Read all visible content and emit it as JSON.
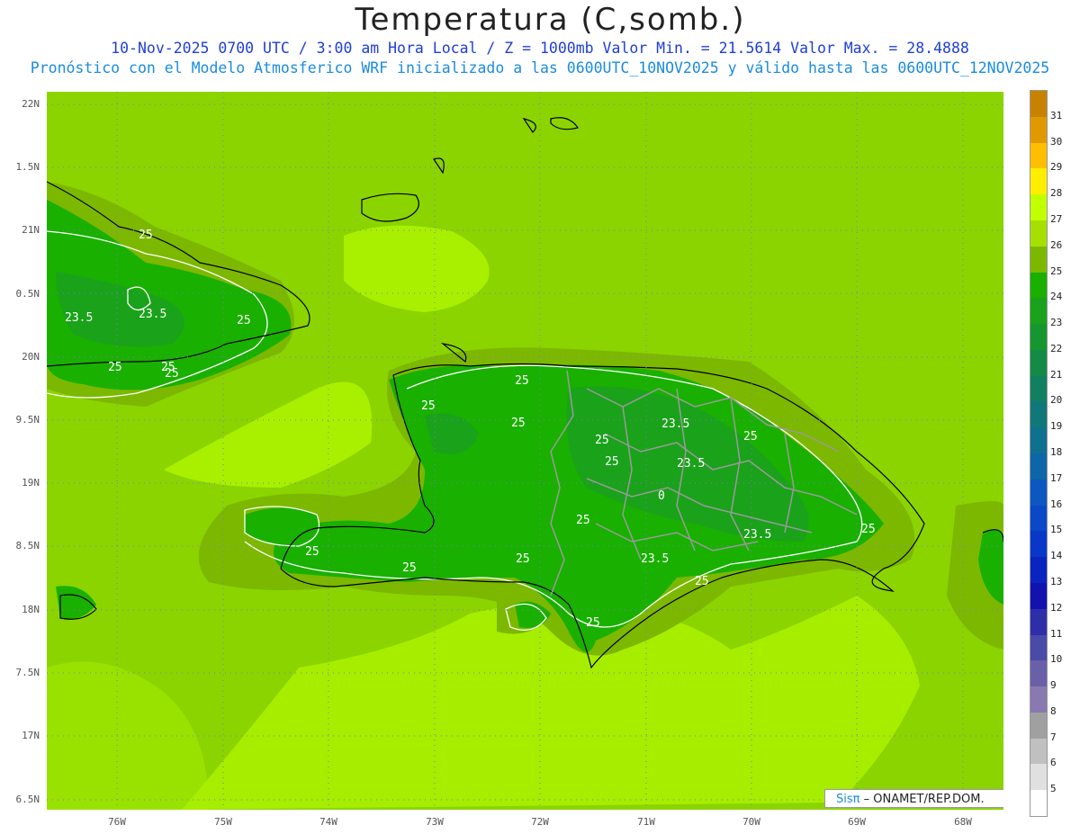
{
  "title": "Temperatura (C,somb.)",
  "subtitle_line1": "10-Nov-2025  0700 UTC / 3:00 am Hora Local / Z = 1000mb   Valor Min. = 21.5614  Valor Max. = 28.4888",
  "subtitle_line2": "Pronóstico con el Modelo Atmosferico WRF inicializado a las 0600UTC_10NOV2025 y válido hasta las  0600UTC_12NOV2025",
  "lat_labels": [
    "22N",
    "1.5N",
    "21N",
    "0.5N",
    "20N",
    "9.5N",
    "19N",
    "8.5N",
    "18N",
    "7.5N",
    "17N",
    "6.5N"
  ],
  "lon_labels": [
    "76W",
    "75W",
    "74W",
    "73W",
    "72W",
    "71W",
    "70W",
    "69W",
    "68W"
  ],
  "colorbar": {
    "labels": [
      "31",
      "30",
      "29",
      "28",
      "27",
      "26",
      "25",
      "24",
      "23",
      "22",
      "21",
      "20",
      "19",
      "18",
      "17",
      "16",
      "15",
      "14",
      "13",
      "12",
      "11",
      "10",
      "9",
      "8",
      "7",
      "6",
      "5"
    ],
    "colors": [
      "#c88200",
      "#e09a00",
      "#ffbe00",
      "#ffee00",
      "#c2ff00",
      "#a6e000",
      "#7cb800",
      "#19b000",
      "#1aa21a",
      "#16962e",
      "#148a46",
      "#128060",
      "#107878",
      "#0f7090",
      "#0d66a8",
      "#0b58c0",
      "#0a48c8",
      "#0938c8",
      "#0a24c0",
      "#1212b0",
      "#2e2ea8",
      "#4a4aa8",
      "#6a60a8",
      "#8a78b0",
      "#a0a0a0",
      "#c0c0c0",
      "#e0e0e0",
      "#ffffff"
    ]
  },
  "contour_labels": [
    "25",
    "23.5",
    "23.5",
    "25",
    "25",
    "25",
    "25",
    "25",
    "25",
    "25",
    "23.5",
    "25",
    "25",
    "23.5",
    "25",
    "0",
    "25",
    "25",
    "25",
    "23.5",
    "23.5",
    "25",
    "25",
    "25",
    "25"
  ],
  "credit": {
    "brand": "Sisπ",
    "org": " – ONAMET/REP.DOM."
  },
  "field_colors": {
    "background": "#8bd400",
    "warm": "#a8f000",
    "cool": "#7cb800",
    "cooler": "#19b000",
    "coolest": "#1aa21a"
  }
}
